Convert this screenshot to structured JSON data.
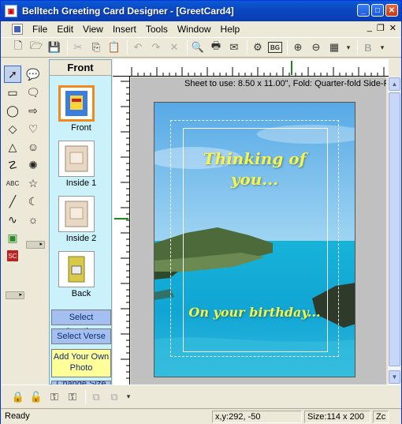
{
  "window": {
    "title": "Belltech Greeting Card Designer  - [GreetCard4]"
  },
  "menu": [
    "File",
    "Edit",
    "View",
    "Insert",
    "Tools",
    "Window",
    "Help"
  ],
  "pages": {
    "heading": "Front",
    "items": [
      {
        "label": "Front",
        "selected": true
      },
      {
        "label": "Inside 1",
        "selected": false
      },
      {
        "label": "Inside 2",
        "selected": false
      },
      {
        "label": "Back",
        "selected": false
      }
    ],
    "buttons": {
      "select_greeting": "Select Greeting",
      "select_verse": "Select Verse",
      "add_photo": "Add Your Own Photo",
      "change_size": "Change Size"
    }
  },
  "canvas": {
    "sheet_info": "Sheet to use: 8.50 x 11.00\", Fold: Quarter-fold Side-F",
    "card_text_top": "Thinking of you...",
    "card_text_bottom": "On your birthday...",
    "colors": {
      "sky": "#7ec3ee",
      "sea": "#12a9d6",
      "text": "#f7f547"
    }
  },
  "status": {
    "ready": "Ready",
    "coords": "x,y:292, -50",
    "size": "Size:114 x 200",
    "zoom": "Zc"
  },
  "icons": {
    "toolbar": [
      "new-icon",
      "open-icon",
      "save-icon",
      "cut-icon",
      "copy-icon",
      "paste-icon",
      "undo-icon",
      "redo-icon",
      "delete-icon",
      "print-preview-icon",
      "print-icon",
      "wizard-icon",
      "properties-icon",
      "background-icon",
      "zoom-in-icon",
      "zoom-out-icon",
      "grid-icon",
      "bold-icon"
    ],
    "shapes": [
      "pointer-icon",
      "callout-icon",
      "rectangle-icon",
      "speech-bubble-icon",
      "ellipse-icon",
      "arrow-icon",
      "diamond-icon",
      "heart-icon",
      "triangle-icon",
      "smiley-icon",
      "freeform-icon",
      "burst-icon",
      "text-icon",
      "star-icon",
      "line-icon",
      "moon-icon",
      "curve-icon",
      "sun-icon",
      "image-icon",
      "clipart-icon"
    ]
  }
}
